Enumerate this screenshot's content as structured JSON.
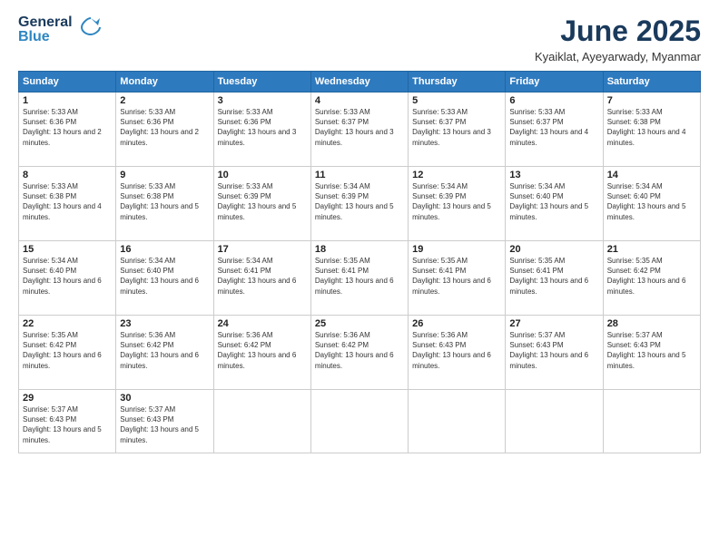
{
  "logo": {
    "line1": "General",
    "line2": "Blue"
  },
  "title": "June 2025",
  "location": "Kyaiklat, Ayeyarwady, Myanmar",
  "days_of_week": [
    "Sunday",
    "Monday",
    "Tuesday",
    "Wednesday",
    "Thursday",
    "Friday",
    "Saturday"
  ],
  "weeks": [
    [
      {
        "day": "1",
        "sunrise": "5:33 AM",
        "sunset": "6:36 PM",
        "daylight": "13 hours and 2 minutes."
      },
      {
        "day": "2",
        "sunrise": "5:33 AM",
        "sunset": "6:36 PM",
        "daylight": "13 hours and 2 minutes."
      },
      {
        "day": "3",
        "sunrise": "5:33 AM",
        "sunset": "6:36 PM",
        "daylight": "13 hours and 3 minutes."
      },
      {
        "day": "4",
        "sunrise": "5:33 AM",
        "sunset": "6:37 PM",
        "daylight": "13 hours and 3 minutes."
      },
      {
        "day": "5",
        "sunrise": "5:33 AM",
        "sunset": "6:37 PM",
        "daylight": "13 hours and 3 minutes."
      },
      {
        "day": "6",
        "sunrise": "5:33 AM",
        "sunset": "6:37 PM",
        "daylight": "13 hours and 4 minutes."
      },
      {
        "day": "7",
        "sunrise": "5:33 AM",
        "sunset": "6:38 PM",
        "daylight": "13 hours and 4 minutes."
      }
    ],
    [
      {
        "day": "8",
        "sunrise": "5:33 AM",
        "sunset": "6:38 PM",
        "daylight": "13 hours and 4 minutes."
      },
      {
        "day": "9",
        "sunrise": "5:33 AM",
        "sunset": "6:38 PM",
        "daylight": "13 hours and 5 minutes."
      },
      {
        "day": "10",
        "sunrise": "5:33 AM",
        "sunset": "6:39 PM",
        "daylight": "13 hours and 5 minutes."
      },
      {
        "day": "11",
        "sunrise": "5:34 AM",
        "sunset": "6:39 PM",
        "daylight": "13 hours and 5 minutes."
      },
      {
        "day": "12",
        "sunrise": "5:34 AM",
        "sunset": "6:39 PM",
        "daylight": "13 hours and 5 minutes."
      },
      {
        "day": "13",
        "sunrise": "5:34 AM",
        "sunset": "6:40 PM",
        "daylight": "13 hours and 5 minutes."
      },
      {
        "day": "14",
        "sunrise": "5:34 AM",
        "sunset": "6:40 PM",
        "daylight": "13 hours and 5 minutes."
      }
    ],
    [
      {
        "day": "15",
        "sunrise": "5:34 AM",
        "sunset": "6:40 PM",
        "daylight": "13 hours and 6 minutes."
      },
      {
        "day": "16",
        "sunrise": "5:34 AM",
        "sunset": "6:40 PM",
        "daylight": "13 hours and 6 minutes."
      },
      {
        "day": "17",
        "sunrise": "5:34 AM",
        "sunset": "6:41 PM",
        "daylight": "13 hours and 6 minutes."
      },
      {
        "day": "18",
        "sunrise": "5:35 AM",
        "sunset": "6:41 PM",
        "daylight": "13 hours and 6 minutes."
      },
      {
        "day": "19",
        "sunrise": "5:35 AM",
        "sunset": "6:41 PM",
        "daylight": "13 hours and 6 minutes."
      },
      {
        "day": "20",
        "sunrise": "5:35 AM",
        "sunset": "6:41 PM",
        "daylight": "13 hours and 6 minutes."
      },
      {
        "day": "21",
        "sunrise": "5:35 AM",
        "sunset": "6:42 PM",
        "daylight": "13 hours and 6 minutes."
      }
    ],
    [
      {
        "day": "22",
        "sunrise": "5:35 AM",
        "sunset": "6:42 PM",
        "daylight": "13 hours and 6 minutes."
      },
      {
        "day": "23",
        "sunrise": "5:36 AM",
        "sunset": "6:42 PM",
        "daylight": "13 hours and 6 minutes."
      },
      {
        "day": "24",
        "sunrise": "5:36 AM",
        "sunset": "6:42 PM",
        "daylight": "13 hours and 6 minutes."
      },
      {
        "day": "25",
        "sunrise": "5:36 AM",
        "sunset": "6:42 PM",
        "daylight": "13 hours and 6 minutes."
      },
      {
        "day": "26",
        "sunrise": "5:36 AM",
        "sunset": "6:43 PM",
        "daylight": "13 hours and 6 minutes."
      },
      {
        "day": "27",
        "sunrise": "5:37 AM",
        "sunset": "6:43 PM",
        "daylight": "13 hours and 6 minutes."
      },
      {
        "day": "28",
        "sunrise": "5:37 AM",
        "sunset": "6:43 PM",
        "daylight": "13 hours and 5 minutes."
      }
    ],
    [
      {
        "day": "29",
        "sunrise": "5:37 AM",
        "sunset": "6:43 PM",
        "daylight": "13 hours and 5 minutes."
      },
      {
        "day": "30",
        "sunrise": "5:37 AM",
        "sunset": "6:43 PM",
        "daylight": "13 hours and 5 minutes."
      },
      null,
      null,
      null,
      null,
      null
    ]
  ]
}
